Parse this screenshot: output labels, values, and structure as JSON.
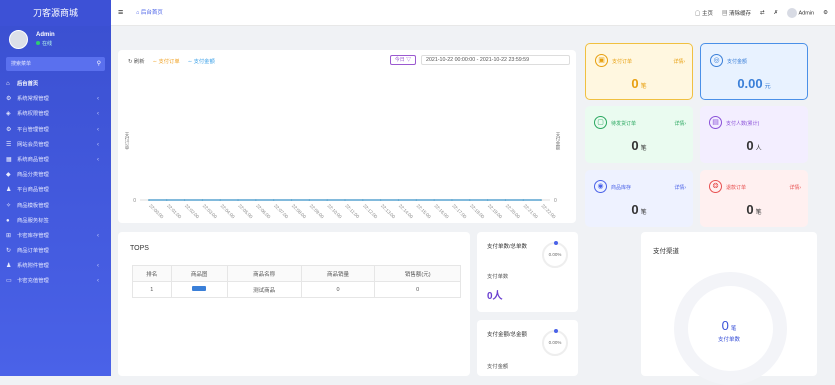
{
  "brand": "刀客源商城",
  "user": {
    "name": "Admin",
    "status": "在线"
  },
  "search": {
    "placeholder": "搜索菜单"
  },
  "nav": [
    {
      "label": "后台首页",
      "icon": "home-icon",
      "active": true,
      "arrow": false
    },
    {
      "label": "系统常规管理",
      "icon": "gear-icon",
      "arrow": true
    },
    {
      "label": "系统权限管理",
      "icon": "shield-icon",
      "arrow": true
    },
    {
      "label": "平台管理管理",
      "icon": "gear-icon",
      "arrow": true
    },
    {
      "label": "网站会员管理",
      "icon": "list-icon",
      "arrow": true
    },
    {
      "label": "系统商品管理",
      "icon": "grid-icon",
      "arrow": true
    },
    {
      "label": "商品分类管理",
      "icon": "tag-icon",
      "arrow": false
    },
    {
      "label": "平台商品管理",
      "icon": "user-icon",
      "arrow": false
    },
    {
      "label": "商品模板管理",
      "icon": "wand-icon",
      "arrow": false
    },
    {
      "label": "商品服务标签",
      "icon": "dot-icon",
      "arrow": false
    },
    {
      "label": "卡密库存管理",
      "icon": "cart-icon",
      "arrow": true
    },
    {
      "label": "商品订单管理",
      "icon": "refresh-icon",
      "arrow": false
    },
    {
      "label": "系统附件管理",
      "icon": "user-icon",
      "arrow": true
    },
    {
      "label": "卡密充值管理",
      "icon": "card-icon",
      "arrow": true
    }
  ],
  "topbar": {
    "tab": "后台首页",
    "links": [
      "主页",
      "清除缓存"
    ],
    "admin": "Admin"
  },
  "chart": {
    "legend": {
      "refresh": "刷新",
      "orders": "支付订单",
      "amount": "支付金额"
    },
    "day_select": "今日 ▽",
    "range": "2021-10-22 00:00:00  -  2021-10-22 23:59:59",
    "ylabel_left": "支付订单",
    "ylabel_right": "支付金额"
  },
  "chart_data": {
    "type": "line",
    "x": [
      "22:00:00",
      "22:01:00",
      "22:02:00",
      "22:03:00",
      "22:04:00",
      "22:05:00",
      "22:06:00",
      "22:07:00",
      "22:08:00",
      "22:09:00",
      "22:10:00",
      "22:11:00",
      "22:12:00",
      "22:13:00",
      "22:14:00",
      "22:15:00",
      "22:16:00",
      "22:17:00",
      "22:18:00",
      "22:19:00",
      "22:20:00",
      "22:21:00",
      "22:22:00"
    ],
    "series": [
      {
        "name": "支付订单",
        "values": [
          0,
          0,
          0,
          0,
          0,
          0,
          0,
          0,
          0,
          0,
          0,
          0,
          0,
          0,
          0,
          0,
          0,
          0,
          0,
          0,
          0,
          0,
          0
        ],
        "color": "#f0a020"
      },
      {
        "name": "支付金额",
        "values": [
          0,
          0,
          0,
          0,
          0,
          0,
          0,
          0,
          0,
          0,
          0,
          0,
          0,
          0,
          0,
          0,
          0,
          0,
          0,
          0,
          0,
          0,
          0
        ],
        "color": "#3aa0e8"
      }
    ],
    "y_left_ticks": [
      "0"
    ],
    "y_right_ticks": [
      "0"
    ]
  },
  "stats": [
    {
      "title": "支付订单",
      "detail": "详情›",
      "value": "0",
      "unit": "笔",
      "icon": "wallet-icon"
    },
    {
      "title": "支付金额",
      "detail": "",
      "value": "0.00",
      "unit": "元",
      "icon": "money-icon"
    },
    {
      "title": "待发货订单",
      "detail": "详情›",
      "value": "0",
      "unit": "笔",
      "icon": "box-icon"
    },
    {
      "title": "支付人数(累计)",
      "detail": "",
      "value": "0",
      "unit": "人",
      "icon": "doc-icon"
    },
    {
      "title": "商品库存",
      "detail": "详情›",
      "value": "0",
      "unit": "笔",
      "icon": "stock-icon"
    },
    {
      "title": "退款订单",
      "detail": "详情›",
      "value": "0",
      "unit": "笔",
      "icon": "refund-icon"
    }
  ],
  "tops": {
    "title": "TOPS",
    "headers": [
      "排名",
      "商品图",
      "商品名称",
      "商品销量",
      "销售额(元)"
    ],
    "rows": [
      {
        "rank": "1",
        "name": "测试商品",
        "sales": "0",
        "amount": "0"
      }
    ]
  },
  "pay1": {
    "title": "支付单数/总单数",
    "ring": "0.00%",
    "label": "支付单数",
    "value": "0人"
  },
  "pay2": {
    "title": "支付金额/总金额",
    "ring": "0.00%",
    "label": "支付金额"
  },
  "channel": {
    "title": "支付渠道",
    "value": "0",
    "unit": "笔",
    "label": "支付单数"
  }
}
